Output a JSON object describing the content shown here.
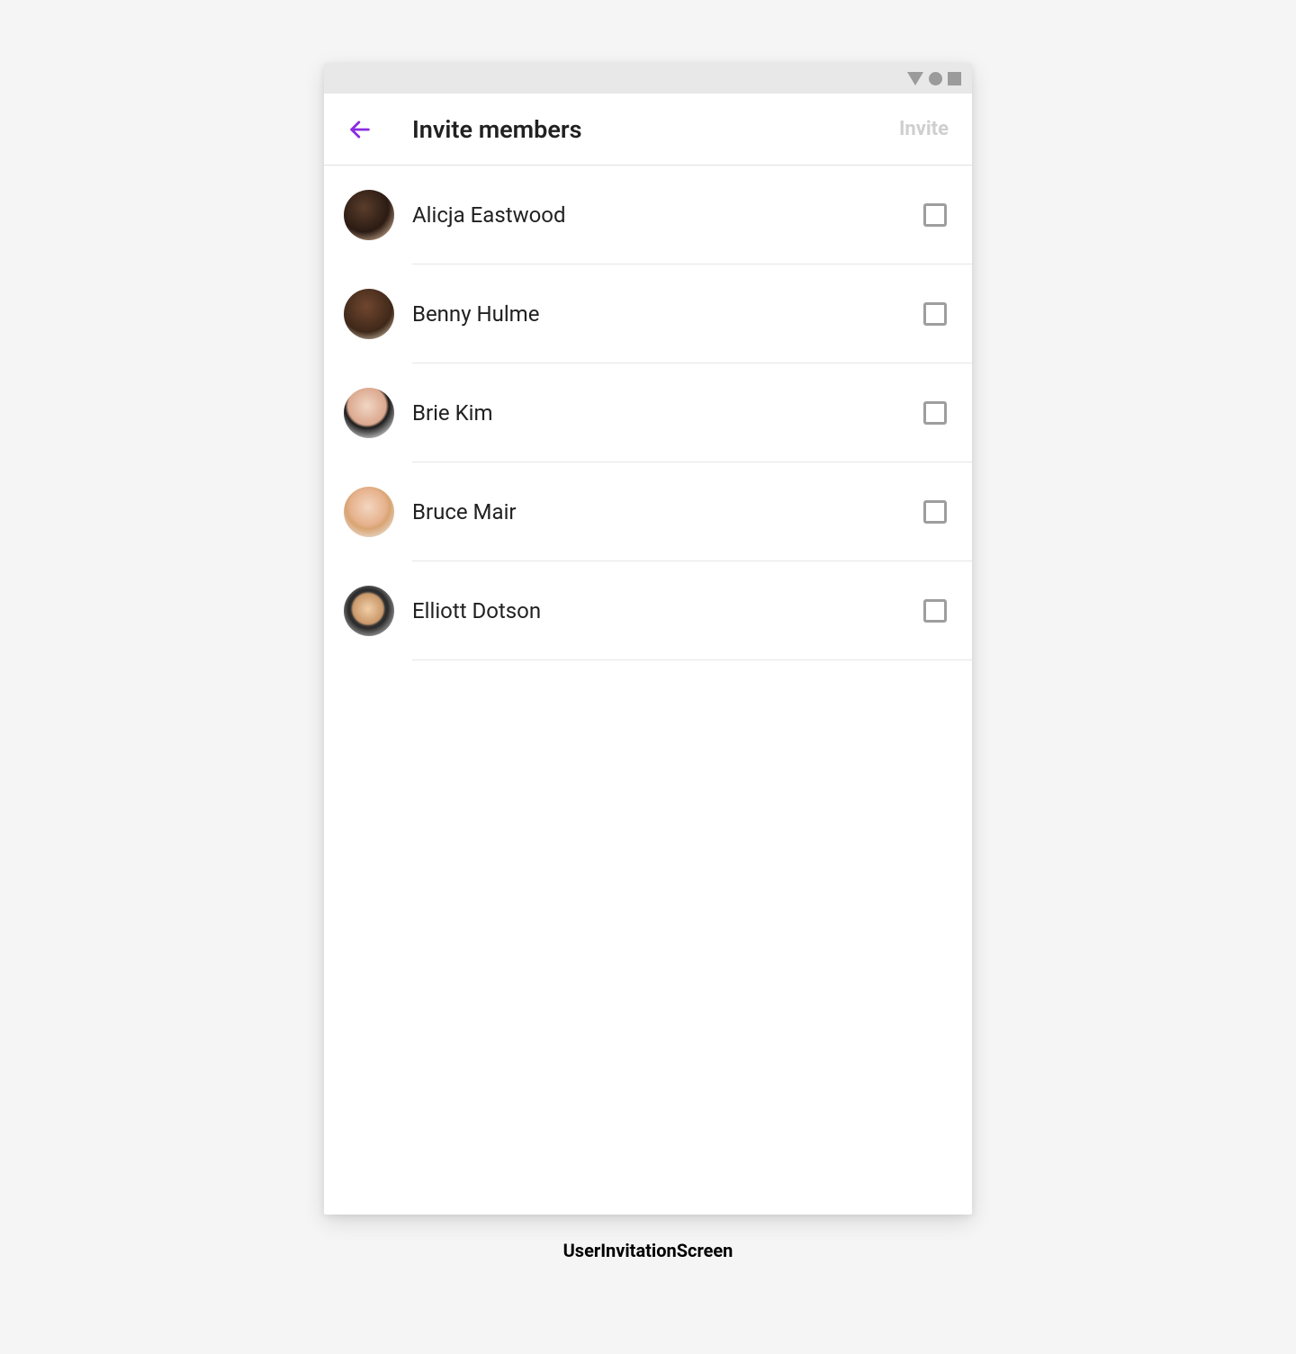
{
  "header": {
    "title": "Invite members",
    "action_label": "Invite"
  },
  "members": [
    {
      "name": "Alicja Eastwood"
    },
    {
      "name": "Benny Hulme"
    },
    {
      "name": "Brie Kim"
    },
    {
      "name": "Bruce Mair"
    },
    {
      "name": "Elliott Dotson"
    }
  ],
  "caption": "UserInvitationScreen",
  "colors": {
    "accent": "#8A2BE2",
    "disabled_text": "#cfcfcf",
    "checkbox_border": "#9E9E9E"
  }
}
